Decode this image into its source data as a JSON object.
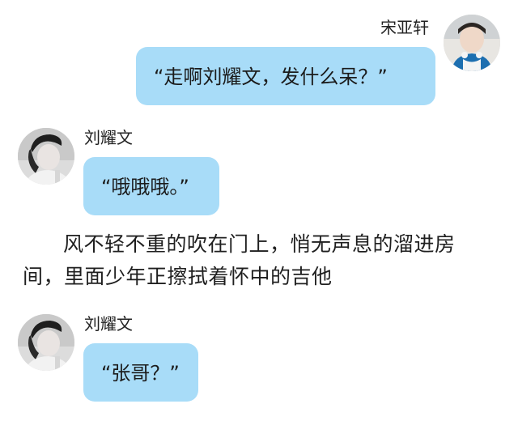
{
  "messages": [
    {
      "sender": "宋亚轩",
      "side": "right",
      "text": "“走啊刘耀文，发什么呆？”",
      "avatar_icon": "avatar-songyaxuan-icon"
    },
    {
      "sender": "刘耀文",
      "side": "left",
      "text": "“哦哦哦。”",
      "avatar_icon": "avatar-liuyaowen-icon"
    },
    {
      "sender": "刘耀文",
      "side": "left",
      "text": "“张哥？”",
      "avatar_icon": "avatar-liuyaowen-icon"
    }
  ],
  "narration": "风不轻不重的吹在门上，悄无声息的溜进房间，里面少年正擦拭着怀中的吉他",
  "colors": {
    "bubble": "#a8dcf8",
    "background": "#ffffff",
    "text": "#1a1a1a"
  }
}
